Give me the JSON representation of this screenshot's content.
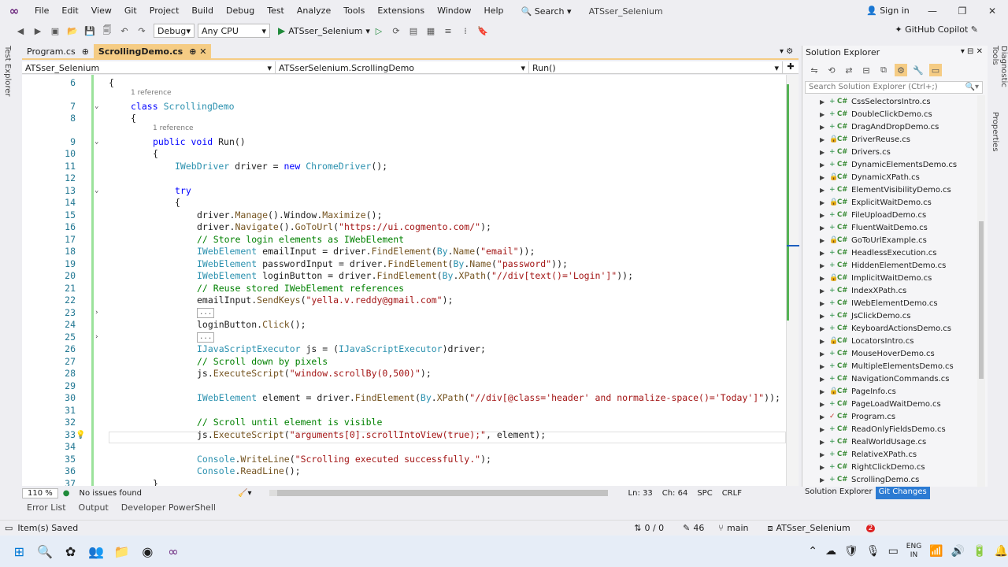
{
  "menubar": {
    "items": [
      "File",
      "Edit",
      "View",
      "Git",
      "Project",
      "Build",
      "Debug",
      "Test",
      "Analyze",
      "Tools",
      "Extensions",
      "Window",
      "Help"
    ],
    "search_label": "Search",
    "app_title": "ATSser_Selenium",
    "sign_in": "Sign in"
  },
  "toolbar": {
    "config": "Debug",
    "platform": "Any CPU",
    "run_target": "ATSser_Selenium",
    "copilot": "GitHub Copilot"
  },
  "tabs": [
    {
      "label": "Program.cs",
      "active": false
    },
    {
      "label": "ScrollingDemo.cs",
      "active": true
    }
  ],
  "navbar": {
    "project": "ATSser_Selenium",
    "class": "ATSserSelenium.ScrollingDemo",
    "member": "Run()"
  },
  "editor": {
    "ref_label": "1 reference",
    "lines": [
      {
        "n": "6",
        "t": "{"
      },
      {
        "n": "7",
        "t": "class ScrollingDemo"
      },
      {
        "n": "8",
        "t": "{"
      },
      {
        "n": "9",
        "t": "public void Run()"
      },
      {
        "n": "10",
        "t": "{"
      },
      {
        "n": "11",
        "t": "IWebDriver driver = new ChromeDriver();"
      },
      {
        "n": "12",
        "t": ""
      },
      {
        "n": "13",
        "t": "try"
      },
      {
        "n": "14",
        "t": "{"
      },
      {
        "n": "15",
        "t": "driver.Manage().Window.Maximize();"
      },
      {
        "n": "16",
        "t": "driver.Navigate().GoToUrl(\"https://ui.cogmento.com/\");"
      },
      {
        "n": "17",
        "t": "// Store login elements as IWebElement"
      },
      {
        "n": "18",
        "t": "IWebElement emailInput = driver.FindElement(By.Name(\"email\"));"
      },
      {
        "n": "19",
        "t": "IWebElement passwordInput = driver.FindElement(By.Name(\"password\"));"
      },
      {
        "n": "20",
        "t": "IWebElement loginButton = driver.FindElement(By.XPath(\"//div[text()='Login']\"));"
      },
      {
        "n": "21",
        "t": "// Reuse stored IWebElement references"
      },
      {
        "n": "22",
        "t": "emailInput.SendKeys(\"yella.v.reddy@gmail.com\");"
      },
      {
        "n": "23",
        "t": "..."
      },
      {
        "n": "24",
        "t": "loginButton.Click();"
      },
      {
        "n": "25",
        "t": "..."
      },
      {
        "n": "26",
        "t": "IJavaScriptExecutor js = (IJavaScriptExecutor)driver;"
      },
      {
        "n": "27",
        "t": "// Scroll down by pixels"
      },
      {
        "n": "28",
        "t": "js.ExecuteScript(\"window.scrollBy(0,500)\");"
      },
      {
        "n": "29",
        "t": ""
      },
      {
        "n": "30",
        "t": "IWebElement element = driver.FindElement(By.XPath(\"//div[@class='header' and normalize-space()='Today']\"));"
      },
      {
        "n": "31",
        "t": ""
      },
      {
        "n": "32",
        "t": "// Scroll until element is visible"
      },
      {
        "n": "33",
        "t": "js.ExecuteScript(\"arguments[0].scrollIntoView(true);\", element);"
      },
      {
        "n": "34",
        "t": ""
      },
      {
        "n": "35",
        "t": "Console.WriteLine(\"Scrolling executed successfully.\");"
      },
      {
        "n": "36",
        "t": "Console.ReadLine();"
      },
      {
        "n": "37",
        "t": "}"
      }
    ]
  },
  "editor_status": {
    "zoom": "110 %",
    "issues": "No issues found",
    "ln": "Ln: 33",
    "ch": "Ch: 64",
    "spc": "SPC",
    "crlf": "CRLF"
  },
  "side_strips": {
    "left": "Test Explorer",
    "right_1": "Diagnostic Tools",
    "right_2": "Properties"
  },
  "solution_explorer": {
    "title": "Solution Explorer",
    "search_placeholder": "Search Solution Explorer (Ctrl+;)",
    "files": [
      {
        "name": "CssSelectorsIntro.cs",
        "status": "+"
      },
      {
        "name": "DoubleClickDemo.cs",
        "status": "+"
      },
      {
        "name": "DragAndDropDemo.cs",
        "status": "+"
      },
      {
        "name": "DriverReuse.cs",
        "status": "lock"
      },
      {
        "name": "Drivers.cs",
        "status": "+"
      },
      {
        "name": "DynamicElementsDemo.cs",
        "status": "+"
      },
      {
        "name": "DynamicXPath.cs",
        "status": "lock"
      },
      {
        "name": "ElementVisibilityDemo.cs",
        "status": "+"
      },
      {
        "name": "ExplicitWaitDemo.cs",
        "status": "lock"
      },
      {
        "name": "FileUploadDemo.cs",
        "status": "+"
      },
      {
        "name": "FluentWaitDemo.cs",
        "status": "+"
      },
      {
        "name": "GoToUrlExample.cs",
        "status": "lock"
      },
      {
        "name": "HeadlessExecution.cs",
        "status": "+"
      },
      {
        "name": "HiddenElementDemo.cs",
        "status": "+"
      },
      {
        "name": "ImplicitWaitDemo.cs",
        "status": "lock"
      },
      {
        "name": "IndexXPath.cs",
        "status": "+"
      },
      {
        "name": "IWebElementDemo.cs",
        "status": "+"
      },
      {
        "name": "JsClickDemo.cs",
        "status": "+"
      },
      {
        "name": "KeyboardActionsDemo.cs",
        "status": "+"
      },
      {
        "name": "LocatorsIntro.cs",
        "status": "lock"
      },
      {
        "name": "MouseHoverDemo.cs",
        "status": "+"
      },
      {
        "name": "MultipleElementsDemo.cs",
        "status": "+"
      },
      {
        "name": "NavigationCommands.cs",
        "status": "+"
      },
      {
        "name": "PageInfo.cs",
        "status": "lock"
      },
      {
        "name": "PageLoadWaitDemo.cs",
        "status": "+"
      },
      {
        "name": "Program.cs",
        "status": "check"
      },
      {
        "name": "ReadOnlyFieldsDemo.cs",
        "status": "+"
      },
      {
        "name": "RealWorldUsage.cs",
        "status": "+"
      },
      {
        "name": "RelativeXPath.cs",
        "status": "+"
      },
      {
        "name": "RightClickDemo.cs",
        "status": "+"
      },
      {
        "name": "ScrollingDemo.cs",
        "status": "+"
      }
    ],
    "tabs": [
      "Solution Explorer",
      "Git Changes"
    ]
  },
  "bottom_tabs": [
    "Error List",
    "Output",
    "Developer PowerShell"
  ],
  "statusbar": {
    "saved": "Item(s) Saved",
    "sync": "0 / 0",
    "edits": "46",
    "branch": "main",
    "repo": "ATSser_Selenium",
    "notif": "2"
  },
  "taskbar": {
    "lang_1": "ENG",
    "lang_2": "IN"
  },
  "colors": {
    "accent_tab": "#f5cc84",
    "git_changes_bg": "#2c7bd3",
    "change_bar": "#9be29b"
  }
}
